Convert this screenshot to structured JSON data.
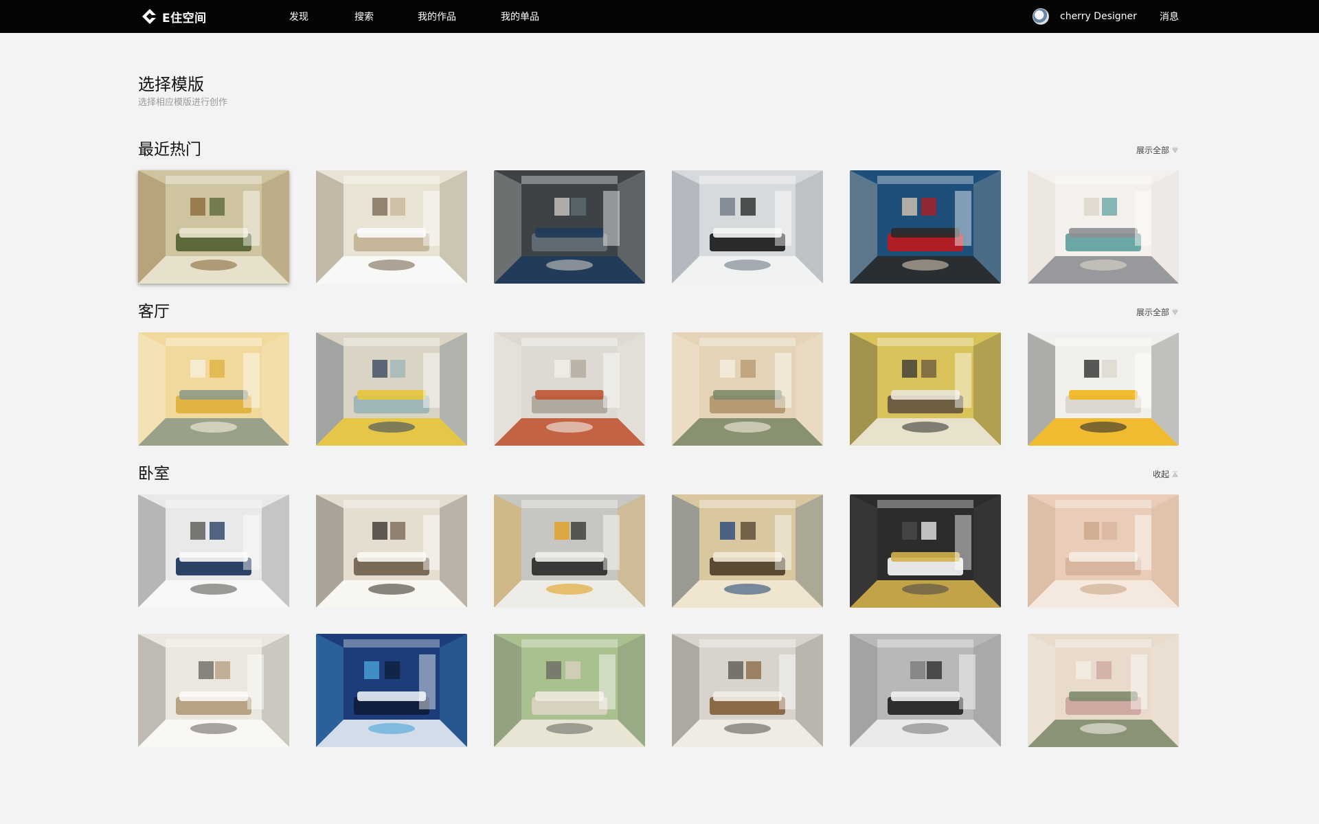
{
  "app": {
    "logo_text": "E住空间",
    "nav": [
      "发现",
      "搜索",
      "我的作品",
      "我的单品"
    ],
    "user_name": "cherry Designer",
    "messages_label": "消息"
  },
  "page": {
    "title": "选择模版",
    "subtitle": "选择相应模版进行创作"
  },
  "sections": [
    {
      "title": "最近热门",
      "toggle_label": "展示全部",
      "items": [
        {
          "name": "hot-template-1",
          "palette": [
            "#cfc4a0",
            "#5c6a3a",
            "#e9e3cf",
            "#8a6b3d"
          ]
        },
        {
          "name": "hot-template-2",
          "palette": [
            "#e9e3d4",
            "#c6b79b",
            "#fafafa",
            "#7a6a55"
          ]
        },
        {
          "name": "hot-template-3",
          "palette": [
            "#3d4247",
            "#5f6a72",
            "#1f3b5c",
            "#c9c7c0"
          ]
        },
        {
          "name": "hot-template-4",
          "palette": [
            "#d7dadd",
            "#2a2a2a",
            "#f4f4f4",
            "#707a85"
          ]
        },
        {
          "name": "hot-template-5",
          "palette": [
            "#1d4f7a",
            "#b01d24",
            "#2a2a2a",
            "#d6c5b0"
          ]
        },
        {
          "name": "hot-template-6",
          "palette": [
            "#f4f1ec",
            "#6aa7a5",
            "#8e8f94",
            "#dcd5ca"
          ]
        }
      ]
    },
    {
      "title": "客厅",
      "toggle_label": "展示全部",
      "items": [
        {
          "name": "living-template-1",
          "palette": [
            "#f0d99b",
            "#e0b343",
            "#8f9a88",
            "#f6f0dc"
          ]
        },
        {
          "name": "living-template-2",
          "palette": [
            "#d9d4c3",
            "#9fb6b8",
            "#e6c53a",
            "#3b4a63"
          ]
        },
        {
          "name": "living-template-3",
          "palette": [
            "#dedad3",
            "#b0a99e",
            "#c15533",
            "#f2efe9"
          ]
        },
        {
          "name": "living-template-4",
          "palette": [
            "#e4d3b7",
            "#b59a72",
            "#7d8a6a",
            "#f5ede0"
          ]
        },
        {
          "name": "living-template-5",
          "palette": [
            "#d9c25a",
            "#6d5f3f",
            "#e9e4d8",
            "#3a3a35"
          ]
        },
        {
          "name": "living-template-6",
          "palette": [
            "#f2f0ec",
            "#dcd8d0",
            "#f0b51d",
            "#2f2f2f"
          ]
        }
      ]
    },
    {
      "title": "卧室",
      "toggle_label": "收起",
      "items": [
        {
          "name": "bedroom-template-1",
          "palette": [
            "#e8e9ea",
            "#2b4266",
            "#fafafa",
            "#5d5a55"
          ]
        },
        {
          "name": "bedroom-template-2",
          "palette": [
            "#e5ddd0",
            "#7a6b58",
            "#faf8f4",
            "#3c3731"
          ]
        },
        {
          "name": "bedroom-template-3",
          "palette": [
            "#c8c6c2",
            "#3a3836",
            "#f1efea",
            "#e0a020"
          ]
        },
        {
          "name": "bedroom-template-4",
          "palette": [
            "#d9c79f",
            "#5a4a33",
            "#f2e8d3",
            "#264a7a"
          ]
        },
        {
          "name": "bedroom-template-5",
          "palette": [
            "#2c2c2c",
            "#e6e6e6",
            "#d3b04a",
            "#4b4b4b"
          ]
        },
        {
          "name": "bedroom-template-6",
          "palette": [
            "#e9cdb8",
            "#d8b59d",
            "#f6ece3",
            "#c9a687"
          ]
        },
        {
          "name": "bedroom-template-7",
          "palette": [
            "#ece7de",
            "#b7a282",
            "#fbfaf7",
            "#6e6a64"
          ]
        },
        {
          "name": "bedroom-template-8",
          "palette": [
            "#1c3d7a",
            "#0f1f3f",
            "#e8eef5",
            "#4aa3d8"
          ]
        },
        {
          "name": "bedroom-template-9",
          "palette": [
            "#a9c08f",
            "#d7d1bf",
            "#efe9dc",
            "#6b6a63"
          ]
        },
        {
          "name": "bedroom-template-10",
          "palette": [
            "#d8d4cd",
            "#8c6a47",
            "#f1eee8",
            "#5f5a53"
          ]
        },
        {
          "name": "bedroom-template-11",
          "palette": [
            "#b8b8b8",
            "#2e2e2e",
            "#f0f0f0",
            "#7a7a7a"
          ]
        },
        {
          "name": "bedroom-template-12",
          "palette": [
            "#e8dbcc",
            "#cfa9a1",
            "#7f8b6d",
            "#f3ede4"
          ]
        }
      ]
    }
  ]
}
